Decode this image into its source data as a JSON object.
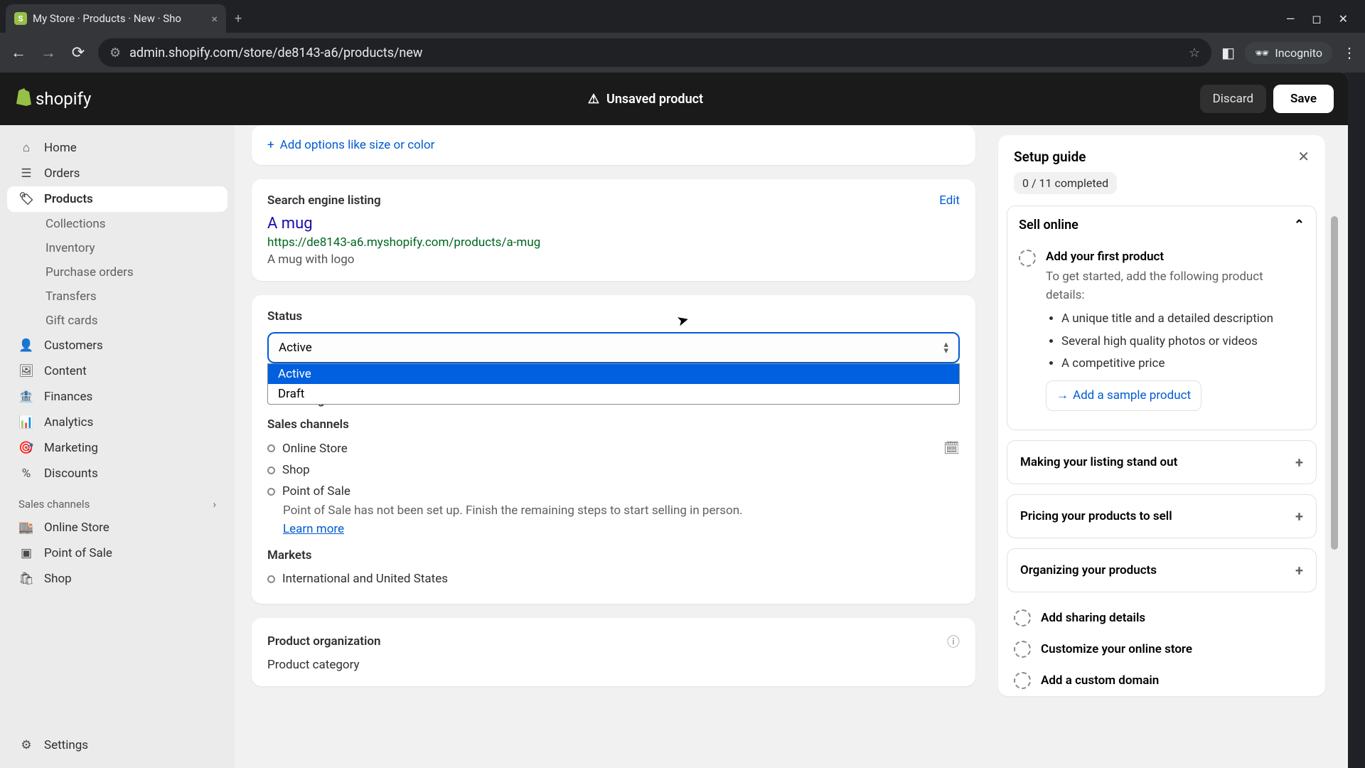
{
  "browser": {
    "tab_title": "My Store · Products · New · Sho",
    "url": "admin.shopify.com/store/de8143-a6/products/new",
    "incognito": "Incognito"
  },
  "header": {
    "brand": "shopify",
    "unsaved": "Unsaved product",
    "discard": "Discard",
    "save": "Save"
  },
  "sidebar": {
    "home": "Home",
    "orders": "Orders",
    "products": "Products",
    "collections": "Collections",
    "inventory": "Inventory",
    "purchase_orders": "Purchase orders",
    "transfers": "Transfers",
    "gift_cards": "Gift cards",
    "customers": "Customers",
    "content": "Content",
    "finances": "Finances",
    "analytics": "Analytics",
    "marketing": "Marketing",
    "discounts": "Discounts",
    "sales_channels": "Sales channels",
    "online_store": "Online Store",
    "point_of_sale": "Point of Sale",
    "shop": "Shop",
    "settings": "Settings"
  },
  "options": {
    "add": "Add options like size or color"
  },
  "seo": {
    "section": "Search engine listing",
    "edit": "Edit",
    "title": "A mug",
    "url": "https://de8143-a6.myshopify.com/products/a-mug",
    "desc": "A mug with logo"
  },
  "status": {
    "label": "Status",
    "selected": "Active",
    "opt_active": "Active",
    "opt_draft": "Draft"
  },
  "publishing": {
    "label": "Publishing",
    "sales_channels": "Sales channels",
    "online_store": "Online Store",
    "shop": "Shop",
    "pos": "Point of Sale",
    "pos_note": "Point of Sale has not been set up. Finish the remaining steps to start selling in person.",
    "learn_more": "Learn more",
    "markets": "Markets",
    "intl_us": "International and United States"
  },
  "org": {
    "section": "Product organization",
    "category": "Product category"
  },
  "setup": {
    "title": "Setup guide",
    "progress": "0 / 11 completed",
    "sell_online": "Sell online",
    "add_first_product": "Add your first product",
    "add_first_desc": "To get started, add the following product details:",
    "b1": "A unique title and a detailed description",
    "b2": "Several high quality photos or videos",
    "b3": "A competitive price",
    "sample": "Add a sample product",
    "stand_out": "Making your listing stand out",
    "pricing": "Pricing your products to sell",
    "organizing": "Organizing your products",
    "sharing": "Add sharing details",
    "customize": "Customize your online store",
    "domain": "Add a custom domain"
  }
}
